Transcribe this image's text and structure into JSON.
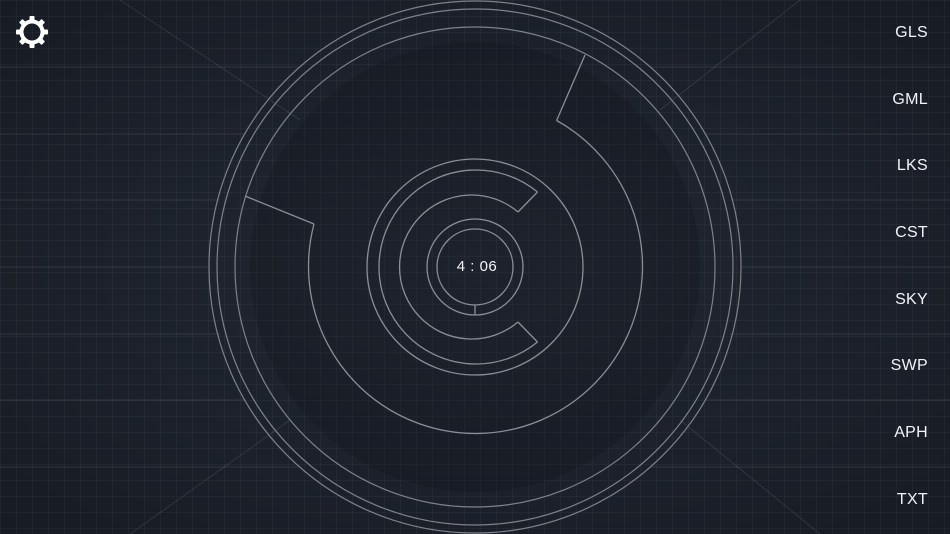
{
  "settings": {
    "icon": "gear-icon"
  },
  "timer": {
    "value": "4 : 06"
  },
  "menu": {
    "items": [
      {
        "label": "GLS"
      },
      {
        "label": "GML"
      },
      {
        "label": "LKS"
      },
      {
        "label": "CST"
      },
      {
        "label": "SKY"
      },
      {
        "label": "SWP"
      },
      {
        "label": "APH"
      },
      {
        "label": "TXT"
      }
    ]
  },
  "colors": {
    "background": "#1a1f28",
    "ring": "#8a8f98",
    "text": "#f2f4f7"
  }
}
